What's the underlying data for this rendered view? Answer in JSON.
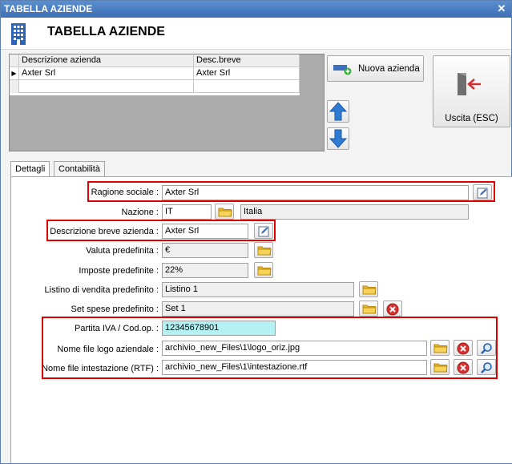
{
  "window": {
    "title": "TABELLA AZIENDE",
    "close_glyph": "✕"
  },
  "header": {
    "title": "TABELLA AZIENDE",
    "icon": "building-icon"
  },
  "grid": {
    "columns": [
      "Descrizione azienda",
      "Desc.breve"
    ],
    "rows": [
      {
        "indicator": "▶",
        "descrizione": "Axter Srl",
        "desc_breve": "Axter Srl"
      }
    ]
  },
  "buttons": {
    "nuova_azienda": "Nuova azienda",
    "uscita": "Uscita (ESC)"
  },
  "tabs": [
    "Dettagli",
    "Contabilità"
  ],
  "form": {
    "ragione_sociale": {
      "label": "Ragione sociale :",
      "value": "Axter Srl"
    },
    "nazione": {
      "label": "Nazione :",
      "code": "IT",
      "name": "Italia"
    },
    "descrizione_breve": {
      "label": "Descrizione breve azienda :",
      "value": "Axter Srl"
    },
    "valuta": {
      "label": "Valuta predefinita :",
      "value": "€"
    },
    "imposte": {
      "label": "Imposte predefinite :",
      "value": "22%"
    },
    "listino": {
      "label": "Listino di vendita predefinito :",
      "value": "Listino 1"
    },
    "set_spese": {
      "label": "Set spese predefinito :",
      "value": "Set 1"
    },
    "partita_iva": {
      "label": "Partita IVA / Cod.op. :",
      "value": "12345678901"
    },
    "logo": {
      "label": "Nome file logo aziendale :",
      "value": "archivio_new_Files\\1\\logo_oriz.jpg"
    },
    "intestazione": {
      "label": "Nome file intestazione (RTF) :",
      "value": "archivio_new_Files\\1\\intestazione.rtf"
    }
  },
  "colors": {
    "title_bar": "#3c6fb4",
    "highlight_border": "#e00000",
    "vat_field_bg": "#b4f1f3",
    "grid_bg": "#ababab"
  }
}
